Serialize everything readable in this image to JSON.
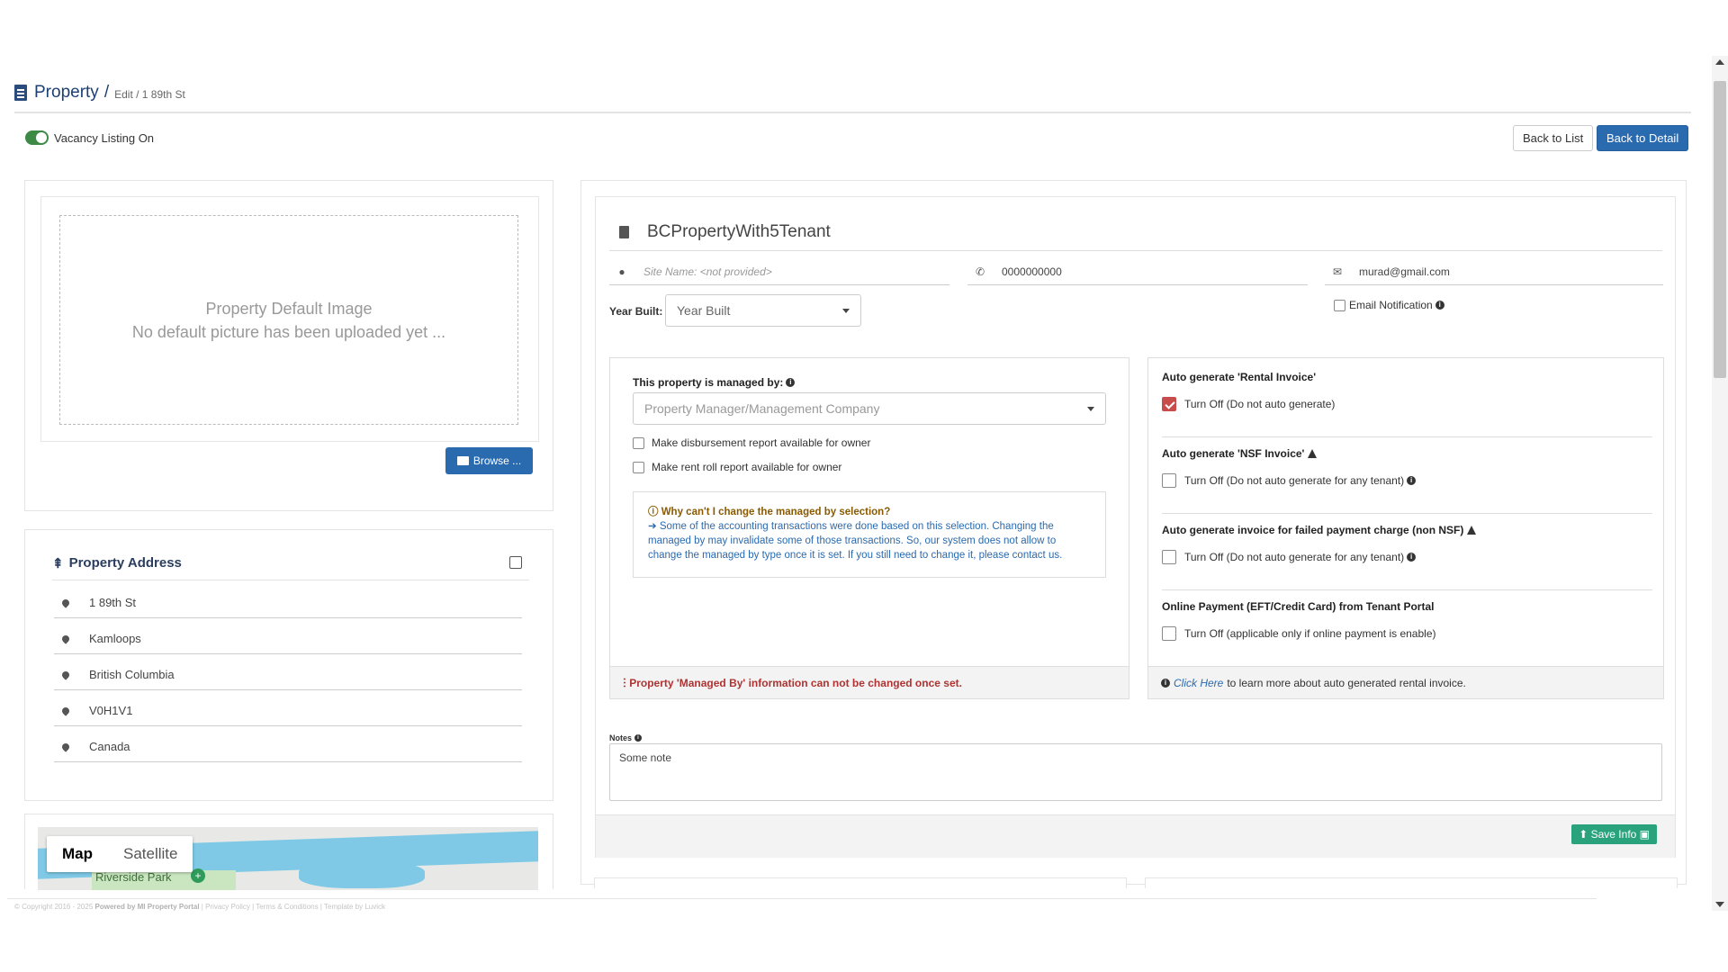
{
  "header": {
    "title": "Property",
    "separator": "/",
    "breadcrumb": "Edit / 1 89th St"
  },
  "vacancy": {
    "label": "Vacancy Listing On",
    "on": true
  },
  "actions": {
    "back_to_list": "Back to List",
    "back_to_detail": "Back to Detail"
  },
  "image_panel": {
    "title": "Property Default Image",
    "subtitle": "No default picture has been uploaded yet ...",
    "browse_label": "Browse ..."
  },
  "address": {
    "title": "Property Address",
    "lines": [
      "1 89th St",
      "Kamloops",
      "British Columbia",
      "V0H1V1",
      "Canada"
    ]
  },
  "map": {
    "tab_map": "Map",
    "tab_satellite": "Satellite",
    "label": "Riverside Park"
  },
  "property": {
    "name": "BCPropertyWith5Tenant",
    "site_name_placeholder": "Site Name: <not provided>",
    "phone": "0000000000",
    "email": "murad@gmail.com",
    "email_notification": "Email Notification",
    "year_built_label": "Year Built:",
    "year_built_value": "Year Built"
  },
  "managed": {
    "title": "This property is managed by:",
    "select_placeholder": "Property Manager/Management Company",
    "disbursement": "Make disbursement report available for owner",
    "rent_roll": "Make rent roll report available for owner",
    "why_title": "Why can't I change the managed by selection?",
    "why_text": "Some of the accounting transactions were done based on this selection. Changing the managed by may invalidate some of those transactions. So, our system does not allow to change the managed by type once it is set. If you still need to change it, please contact us.",
    "footer": "Property 'Managed By' information can not be changed once set."
  },
  "auto": {
    "rental_title": "Auto generate 'Rental Invoice'",
    "rental_opt": "Turn Off (Do not auto generate)",
    "nsf_title": "Auto generate 'NSF Invoice'",
    "nsf_opt": "Turn Off (Do not auto generate for any tenant)",
    "failed_title": "Auto generate invoice for failed payment charge (non NSF)",
    "failed_opt": "Turn Off (Do not auto generate for any tenant)",
    "online_title": "Online Payment (EFT/Credit Card) from Tenant Portal",
    "online_opt": "Turn Off (applicable only if online payment is enable)",
    "footer_link": "Click Here",
    "footer_text": "to learn more about auto generated rental invoice."
  },
  "notes": {
    "label": "Notes",
    "value": "Some note"
  },
  "save_label": "Save Info",
  "footer": {
    "copyright": "© Copyright 2016 - 2025",
    "powered": "Powered by MI Property Portal",
    "links": "| Privacy Policy | Terms & Conditions |",
    "template": "Template by Luvick"
  }
}
